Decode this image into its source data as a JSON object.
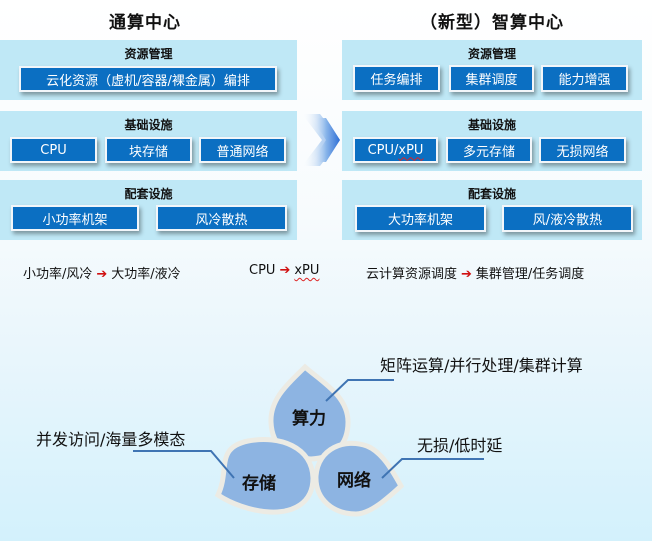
{
  "left": {
    "title": "通算中心",
    "resource": {
      "title": "资源管理",
      "items": [
        "云化资源（虚机/容器/裸金属）编排"
      ]
    },
    "infra": {
      "title": "基础设施",
      "items": [
        "CPU",
        "块存储",
        "普通网络"
      ]
    },
    "support": {
      "title": "配套设施",
      "items": [
        "小功率机架",
        "风冷散热"
      ]
    }
  },
  "right": {
    "title": "（新型）智算中心",
    "resource": {
      "title": "资源管理",
      "items": [
        "任务编排",
        "集群调度",
        "能力增强"
      ]
    },
    "infra": {
      "title": "基础设施",
      "items": [
        "CPU/",
        "xPU",
        "多元存储",
        "无损网络"
      ]
    },
    "support": {
      "title": "配套设施",
      "items": [
        "大功率机架",
        "风/液冷散热"
      ]
    }
  },
  "transition_icon": "chevron-right-icon",
  "summary": [
    {
      "from": "小功率/风冷",
      "to": "大功率/液冷"
    },
    {
      "from": "CPU",
      "to": "xPU"
    },
    {
      "from": "云计算资源调度",
      "to": "集群管理/任务调度"
    }
  ],
  "arrow_glyph": "➔",
  "petals": {
    "compute": "算力",
    "storage": "存储",
    "network": "网络"
  },
  "callouts": {
    "compute": "矩阵运算/并行处理/集群计算",
    "storage": "并发访问/海量多模态",
    "network": "无损/低时延"
  },
  "colors": {
    "panel": "#bfe8f6",
    "button": "#0b6fc2",
    "petal": "#8db4e2",
    "petal_border": "#ecebe4",
    "leader_line": "#3f74b3",
    "arrow_red": "#d01010"
  }
}
